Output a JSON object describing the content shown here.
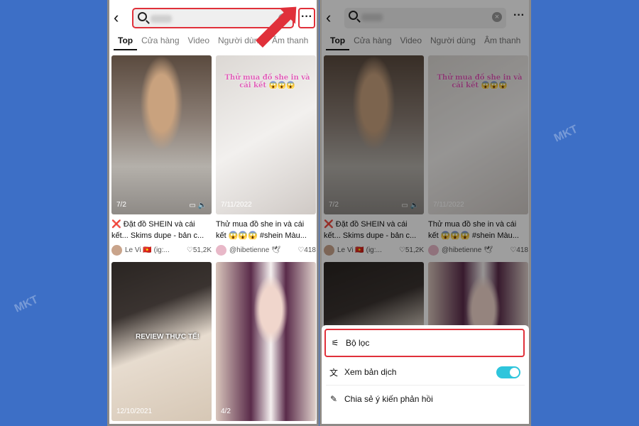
{
  "search": {
    "clear_icon": "×",
    "more_label": "···"
  },
  "tabs": [
    "Top",
    "Cửa hàng",
    "Video",
    "Người dùng",
    "Âm thanh"
  ],
  "videos": [
    {
      "date": "7/2",
      "caption": "❌ Đặt đồ SHEIN và cái kết... Skims dupe - bản c...",
      "author": "Le Vi 🇻🇳 (ig:...",
      "likes": "♡51,2K"
    },
    {
      "date": "7/11/2022",
      "overlay": "Thử mua đồ she in và cái kết 😱😱😱",
      "caption": "Thử mua đồ she in và cái kết 😱😱😱 #shein Màu...",
      "author": "@hibetienne 🕊",
      "likes": "♡418"
    },
    {
      "date": "12/10/2021",
      "overlay": "REVIEW THỰC TẾ!"
    },
    {
      "date": "4/2"
    }
  ],
  "menu": {
    "filter": "Bộ lọc",
    "translate": "Xem bản dịch",
    "translate_on": true,
    "feedback": "Chia sẻ ý kiến phản hồi"
  },
  "colors": {
    "highlight": "#e0303a",
    "toggle": "#2ec5dc",
    "background": "#3d6fc6"
  },
  "watermark": "MKT"
}
